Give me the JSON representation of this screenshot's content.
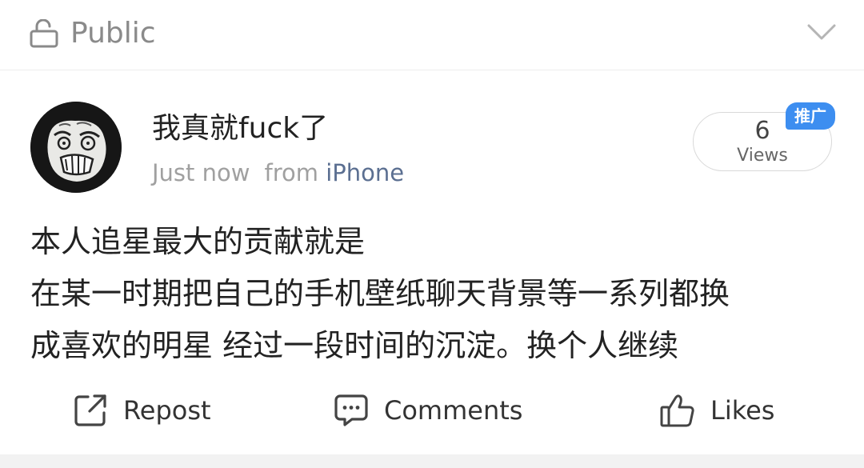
{
  "topbar": {
    "visibility_label": "Public",
    "lock_icon": "unlocked-padlock",
    "chevron_icon": "chevron-down"
  },
  "post": {
    "author_name": "我真就fuck了",
    "time": "Just now",
    "from_label": "from",
    "source": "iPhone",
    "views": {
      "count": "6",
      "label": "Views"
    },
    "promo_badge": "推广",
    "body_lines": [
      "本人追星最大的贡献就是",
      "在某一时期把自己的手机壁纸聊天背景等一系列都换",
      "成喜欢的明星 经过一段时间的沉淀。换个人继续"
    ]
  },
  "actions": {
    "repost": "Repost",
    "comments": "Comments",
    "likes": "Likes"
  },
  "colors": {
    "source_link": "#5b6f91",
    "badge": "#3d8ef0",
    "muted_text": "#a0a0a0"
  }
}
